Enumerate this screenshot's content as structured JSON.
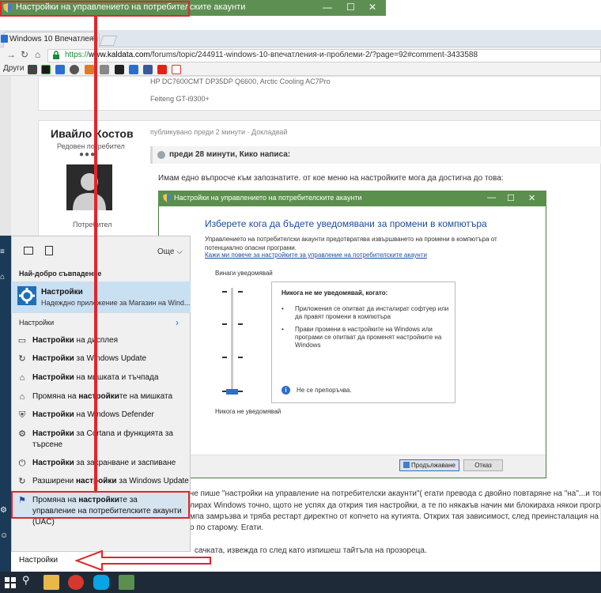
{
  "window": {
    "title": "Настройки на управлението на потребителските акаунти"
  },
  "browser": {
    "tab_title": "Windows 10 Впечатлени",
    "tab_close": "×",
    "url_prefix": "https://",
    "url_domain": "www.kaldata.com",
    "url_rest": "/forums/topic/244911-windows-10-впечатления-и-проблеми-2/?page=92#comment-3433588",
    "bookmarks_label": "Други"
  },
  "forum": {
    "prev_sig_line1": "HP DC7600CMT DP35DP Q6600, Arctic Cooling AC7Pro",
    "prev_sig_line2": "Feiteng GT-i9300+",
    "author_name": "Ивайло Костов",
    "author_role": "Редовен потребител",
    "author_dots": "●●●",
    "author_group": "Потребител",
    "post_meta": "публикувано преди 2 минути · Докладвай",
    "quote_header": "преди 28 минути, Кико написа:",
    "question": "Имам едно въпросче към запознатите. от кое меню на настройките мога да достигна до това:",
    "text_lines": [
      "че пише \"настройки на управление на потребителски акаунти\"( егати превода с двойно повтаряне на \"на\"...и това тр",
      "лирах Windows  точно, щото не успях да открия тия настройки, а те по някакъв начин ми блокираха някои програми и",
      "мпа замръзва и тряба рестарт директно от копчето на кутията. Открих тая зависимост, след преинсталация на Window",
      "о по старому. Егати.",
      "сачката, извежда го след като изпишеш тайтъла на прозореца."
    ]
  },
  "uac_dialog": {
    "title": "Настройки на управлението на потребителските акаунти",
    "heading": "Изберете кога да бъдете уведомявани за промени в компютъра",
    "description": "Управлението на потребителски акаунти предотвратява извършването на промени в компютъра от потенциално опасни програми.",
    "link": "Кажи ми повече за настройките за управление на потребителските акаунти",
    "always_label": "Винаги уведомявай",
    "never_label": "Никога не уведомявай",
    "slider_level": "0 of 3",
    "box_title": "Никога не ме уведомявай, когато:",
    "bullets": [
      "Приложения се опитват да инсталират софтуер или да правят промени в компютъра",
      "Прави промени в настройките на Windows или програми се опитват да променят настройките на Windows"
    ],
    "bullet_glyph": "•",
    "info_glyph": "i",
    "warning": "Не се препоръчва.",
    "ok_label": "Продължаване",
    "cancel_label": "Отказ"
  },
  "start_menu": {
    "more_label": "Още",
    "best_match_header": "Най-добро съвпадение",
    "best_match_title": "Настройки",
    "best_match_subtitle": "Надеждно приложение за Магазин на Wind...",
    "section_header": "Настройки",
    "section_arrow": "›",
    "items": [
      {
        "bold": "Настройки",
        "rest": " на дисплея",
        "icon": "monitor-icon",
        "glyph": "▭"
      },
      {
        "bold": "Настройки",
        "rest": " за Windows Update",
        "icon": "refresh-icon",
        "glyph": "↻"
      },
      {
        "bold": "Настройки",
        "rest": " на мишката и тъчпада",
        "icon": "mouse-icon",
        "glyph": "⌂"
      },
      {
        "pre": "Промяна на ",
        "bold": "настройки",
        "rest": "те на мишката",
        "icon": "mouse-icon",
        "glyph": "⌂"
      },
      {
        "bold": "Настройки",
        "rest": " на Windows Defender",
        "icon": "shield-icon",
        "glyph": "⛨"
      },
      {
        "bold": "Настройки",
        "rest": " за Cortana и функцията за търсене",
        "icon": "gear-icon",
        "glyph": "⚙"
      },
      {
        "bold": "Настройки",
        "rest": " за захранване и заспиване",
        "icon": "power-icon",
        "glyph": "⏻"
      },
      {
        "pre": "Разширени ",
        "bold": "настройки",
        "rest": " за Windows Update",
        "icon": "refresh-icon",
        "glyph": "↻"
      },
      {
        "pre": "Промяна на ",
        "bold": "настройки",
        "rest": "те за управление на потребителските акаунти (UAC)",
        "icon": "flag-icon",
        "glyph": "⚑"
      }
    ],
    "search_text": "Настройки"
  },
  "colors": {
    "uac_green": "#5b8f4e",
    "highlight_red": "#e0262c",
    "link_blue": "#1a4d9e",
    "taskbar": "#1e2a38"
  }
}
